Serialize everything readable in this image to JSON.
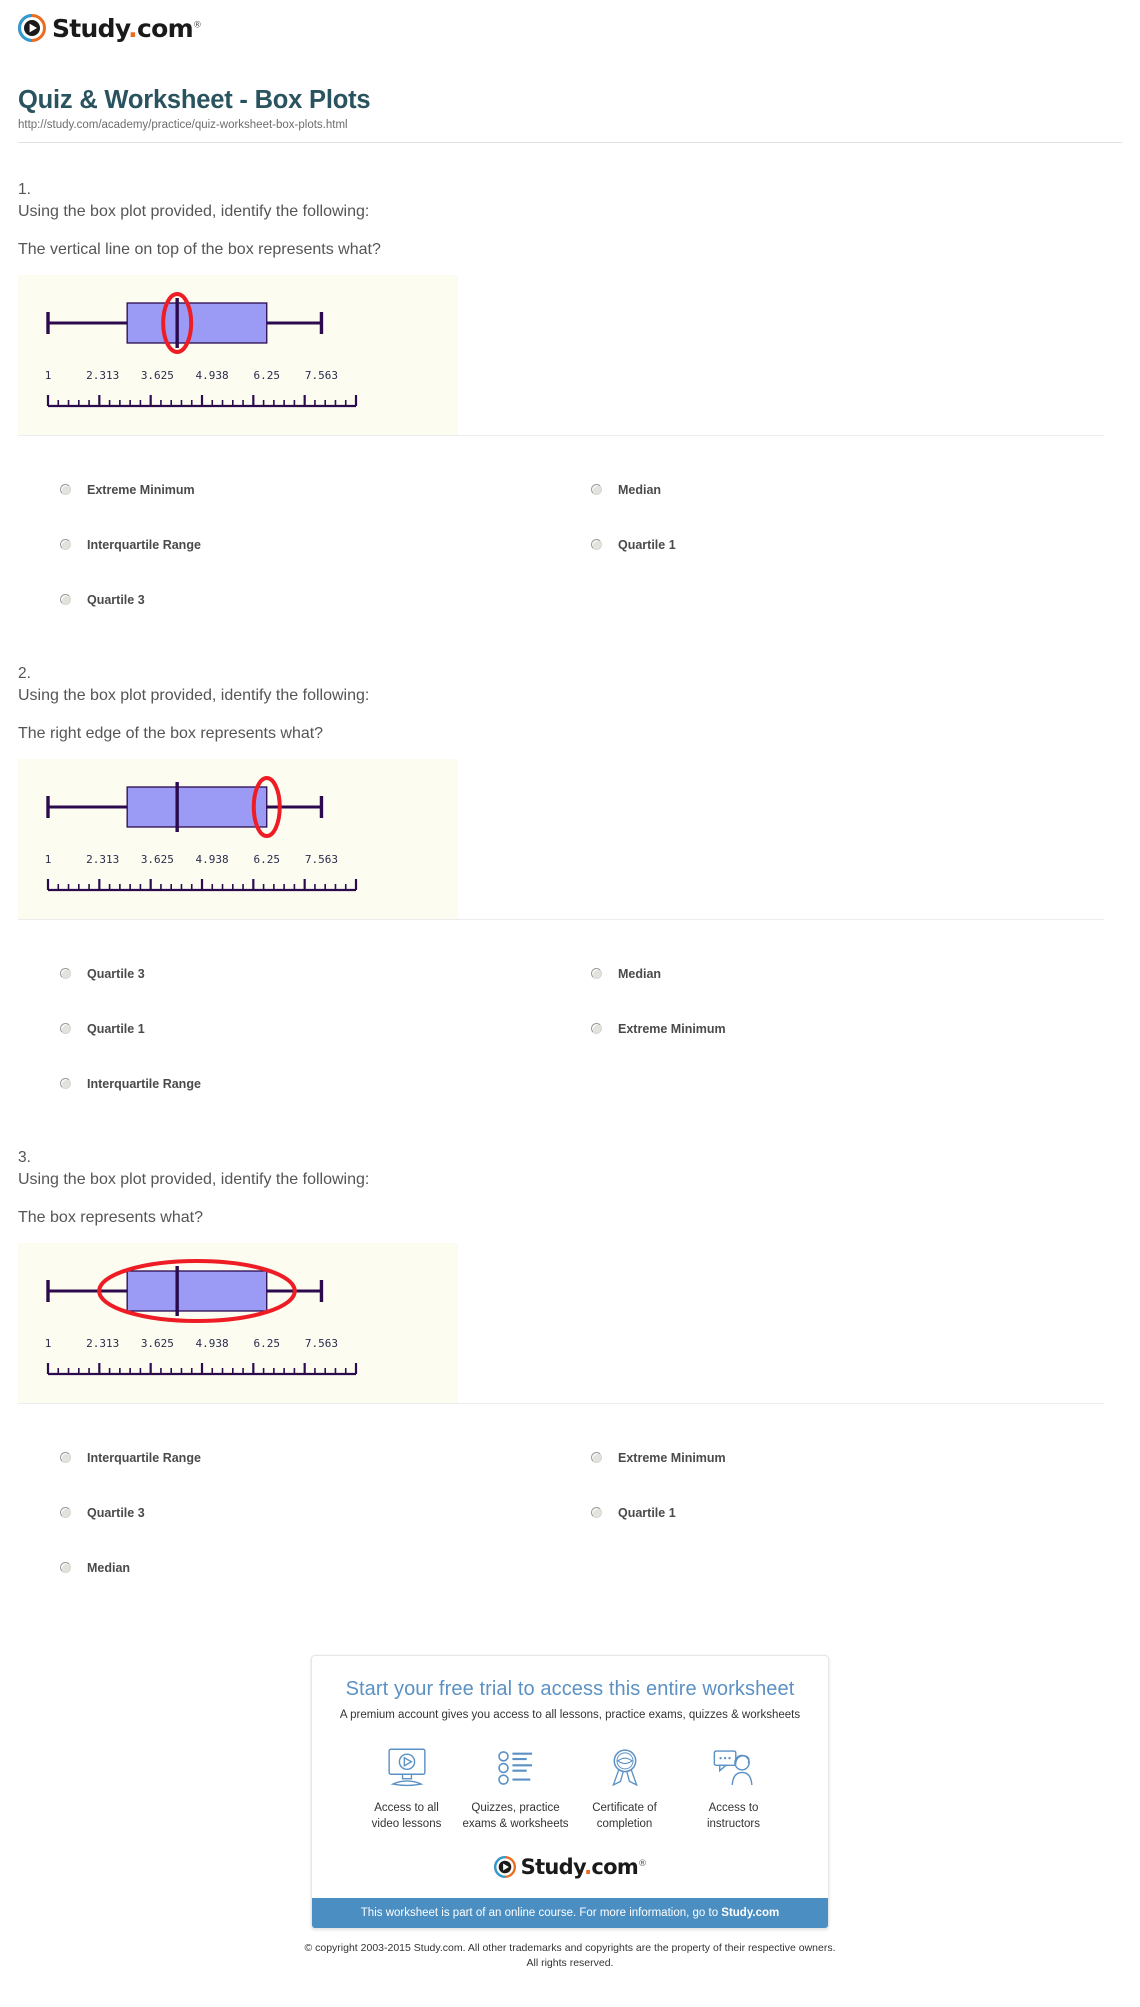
{
  "header": {
    "logo_name": "Study",
    "logo_dot": ".",
    "logo_com": "com",
    "logo_reg": "®"
  },
  "title": "Quiz & Worksheet - Box Plots",
  "url": "http://study.com/academy/practice/quiz-worksheet-box-plots.html",
  "boxplot": {
    "type": "boxplot",
    "tick_labels": [
      "1",
      "2.313",
      "3.625",
      "4.938",
      "6.25",
      "7.563"
    ],
    "axis_min": 1,
    "axis_max": 8.2,
    "whisker_low": 1,
    "q1": 2.9,
    "median": 4.1,
    "q3": 6.25,
    "whisker_high": 7.563,
    "box_fill": "#9b9bf5",
    "line_color": "#2b0a4e",
    "highlight_color": "#ee1c25",
    "figure_bg": "#fcfdf0"
  },
  "questions": [
    {
      "number": "1.",
      "stem": "Using the box plot provided, identify the following:",
      "prompt": "The vertical line on top of the box represents what?",
      "highlight": "median",
      "options": [
        "Extreme Minimum",
        "Median",
        "Interquartile Range",
        "Quartile 1",
        "Quartile 3"
      ]
    },
    {
      "number": "2.",
      "stem": "Using the box plot provided, identify the following:",
      "prompt": "The right edge of the box represents what?",
      "highlight": "q3",
      "options": [
        "Quartile 3",
        "Median",
        "Quartile 1",
        "Extreme Minimum",
        "Interquartile Range"
      ]
    },
    {
      "number": "3.",
      "stem": "Using the box plot provided, identify the following:",
      "prompt": "The box represents what?",
      "highlight": "box",
      "options": [
        "Interquartile Range",
        "Extreme Minimum",
        "Quartile 3",
        "Quartile 1",
        "Median"
      ]
    }
  ],
  "promo": {
    "title": "Start your free trial to access this entire worksheet",
    "subtitle": "A premium account gives you access to all lessons, practice exams, quizzes & worksheets",
    "features": [
      {
        "icon": "monitor-play-icon",
        "label": "Access to all\nvideo lessons"
      },
      {
        "icon": "checklist-icon",
        "label": "Quizzes, practice\nexams & worksheets"
      },
      {
        "icon": "certificate-ribbon-icon",
        "label": "Certificate of\ncompletion"
      },
      {
        "icon": "instructor-chat-icon",
        "label": "Access to\ninstructors"
      }
    ],
    "bar_text_prefix": "This worksheet is part of an online course. For more information, go to ",
    "bar_text_link": "Study.com",
    "bar_color": "#4a8ec2"
  },
  "copyright_line1": "© copyright 2003-2015 Study.com. All other trademarks and copyrights are the property of their respective owners.",
  "copyright_line2": "All rights reserved."
}
